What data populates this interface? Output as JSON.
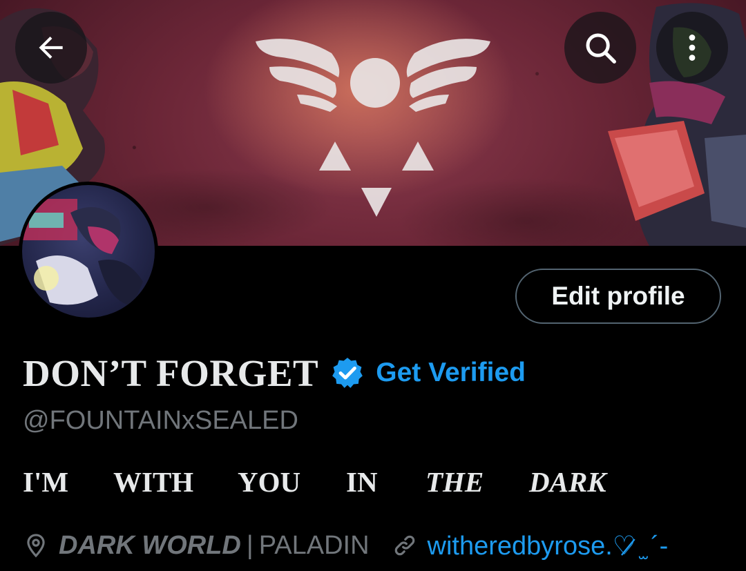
{
  "header": {
    "back_icon": "arrow-left-icon",
    "search_icon": "search-icon",
    "more_icon": "more-vertical-icon"
  },
  "profile": {
    "edit_label": "Edit profile",
    "display_name": "DON’T FORGET",
    "verified_icon": "verified-badge-icon",
    "get_verified_label": "Get Verified",
    "handle": "@FOUNTAINxSEALED",
    "bio_words": [
      "I'M",
      "WITH",
      "YOU",
      "IN",
      "THE",
      "DARK"
    ],
    "location_icon": "location-pin-icon",
    "location_bold": "DARK WORLD",
    "location_sep": "|",
    "location_rest": "PALADIN",
    "link_icon": "link-icon",
    "link_text": "witheredbyrose.♡̷ ̫ ´-"
  },
  "colors": {
    "background": "#000000",
    "accent": "#1d9bf0",
    "muted_text": "#71767b",
    "primary_text": "#e7e9ea",
    "banner": "#6b2637"
  }
}
